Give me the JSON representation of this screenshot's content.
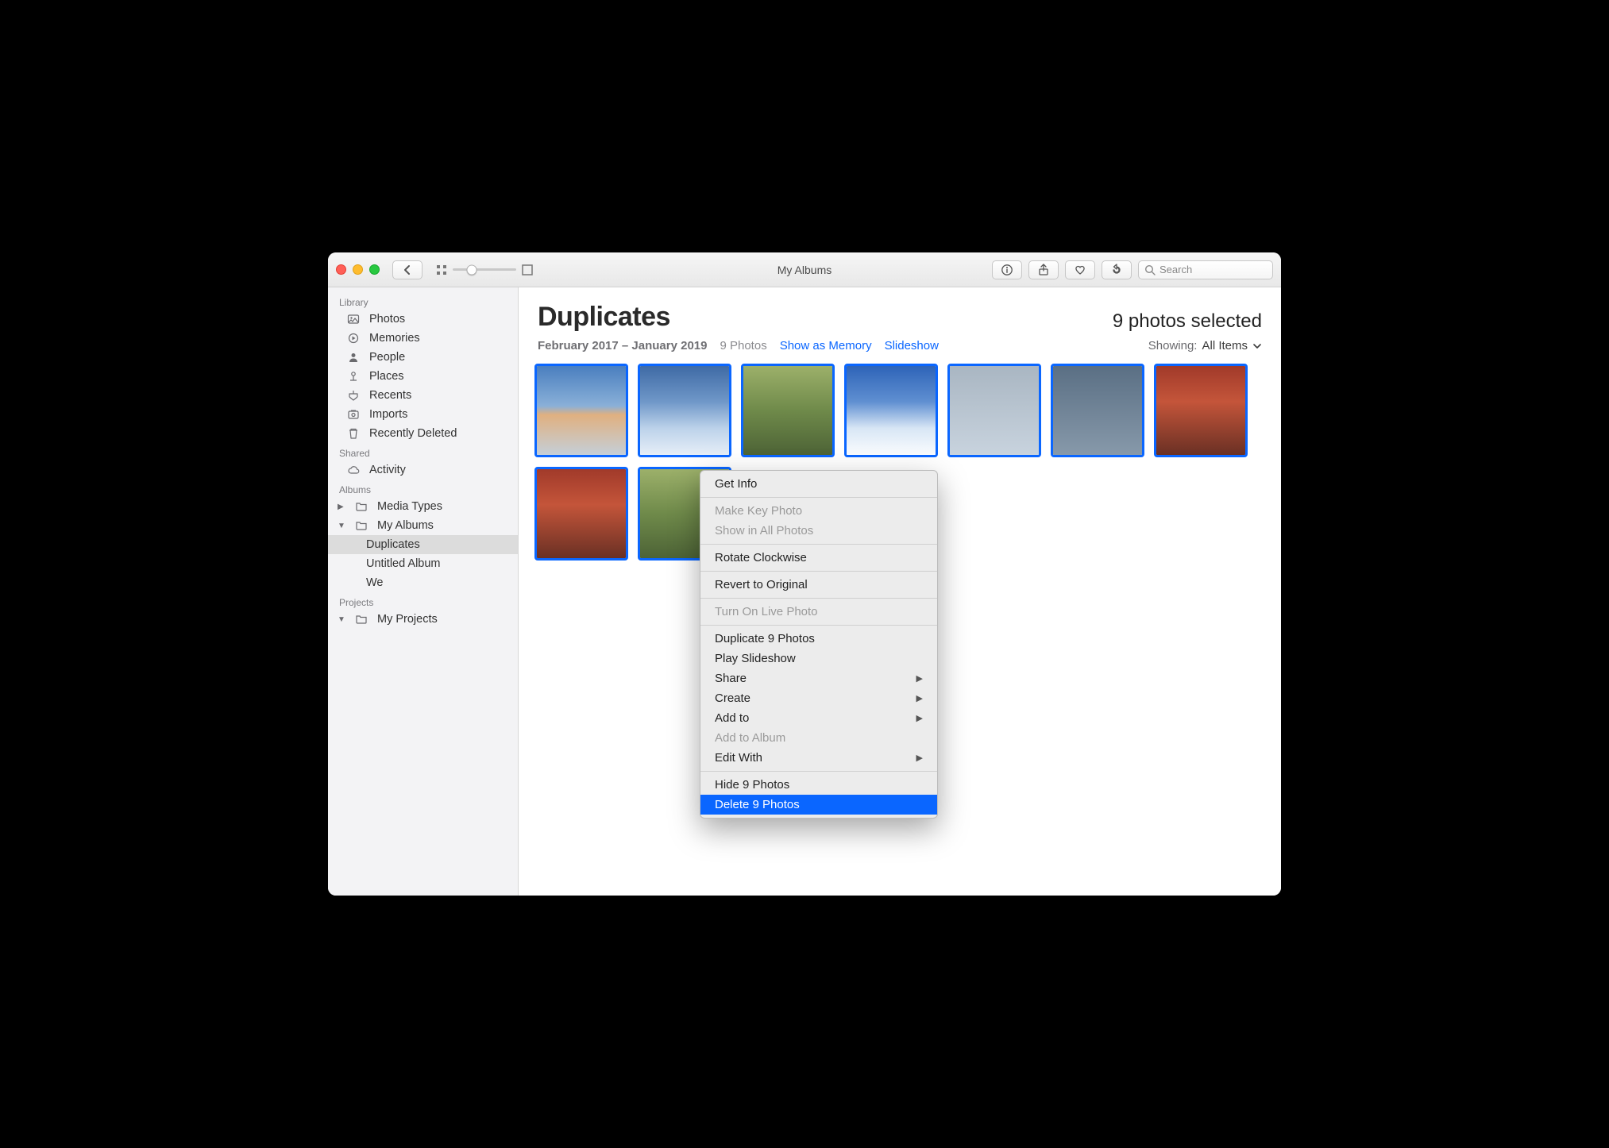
{
  "window": {
    "title": "My Albums"
  },
  "toolbar": {
    "search_placeholder": "Search"
  },
  "sidebar": {
    "sections": {
      "library": {
        "title": "Library",
        "items": [
          {
            "label": "Photos"
          },
          {
            "label": "Memories"
          },
          {
            "label": "People"
          },
          {
            "label": "Places"
          },
          {
            "label": "Recents"
          },
          {
            "label": "Imports"
          },
          {
            "label": "Recently Deleted"
          }
        ]
      },
      "shared": {
        "title": "Shared",
        "items": [
          {
            "label": "Activity"
          }
        ]
      },
      "albums": {
        "title": "Albums",
        "items": [
          {
            "label": "Media Types"
          },
          {
            "label": "My Albums"
          }
        ],
        "my_albums_children": [
          {
            "label": "Duplicates"
          },
          {
            "label": "Untitled Album"
          },
          {
            "label": "We"
          }
        ]
      },
      "projects": {
        "title": "Projects",
        "items": [
          {
            "label": "My Projects"
          }
        ]
      }
    }
  },
  "main": {
    "album_title": "Duplicates",
    "selection_text": "9 photos selected",
    "date_range": "February 2017 – January 2019",
    "photo_count_text": "9 Photos",
    "show_as_memory": "Show as Memory",
    "slideshow": "Slideshow",
    "showing_label": "Showing:",
    "showing_value": "All Items"
  },
  "context_menu": {
    "items": [
      {
        "label": "Get Info",
        "enabled": true
      },
      {
        "sep": true
      },
      {
        "label": "Make Key Photo",
        "enabled": false
      },
      {
        "label": "Show in All Photos",
        "enabled": false
      },
      {
        "sep": true
      },
      {
        "label": "Rotate Clockwise",
        "enabled": true
      },
      {
        "sep": true
      },
      {
        "label": "Revert to Original",
        "enabled": true
      },
      {
        "sep": true
      },
      {
        "label": "Turn On Live Photo",
        "enabled": false
      },
      {
        "sep": true
      },
      {
        "label": "Duplicate 9 Photos",
        "enabled": true
      },
      {
        "label": "Play Slideshow",
        "enabled": true
      },
      {
        "label": "Share",
        "enabled": true,
        "submenu": true
      },
      {
        "label": "Create",
        "enabled": true,
        "submenu": true
      },
      {
        "label": "Add to",
        "enabled": true,
        "submenu": true
      },
      {
        "label": "Add to Album",
        "enabled": false
      },
      {
        "label": "Edit With",
        "enabled": true,
        "submenu": true
      },
      {
        "sep": true
      },
      {
        "label": "Hide 9 Photos",
        "enabled": true
      },
      {
        "label": "Delete 9 Photos",
        "enabled": true,
        "highlight": true
      }
    ]
  }
}
